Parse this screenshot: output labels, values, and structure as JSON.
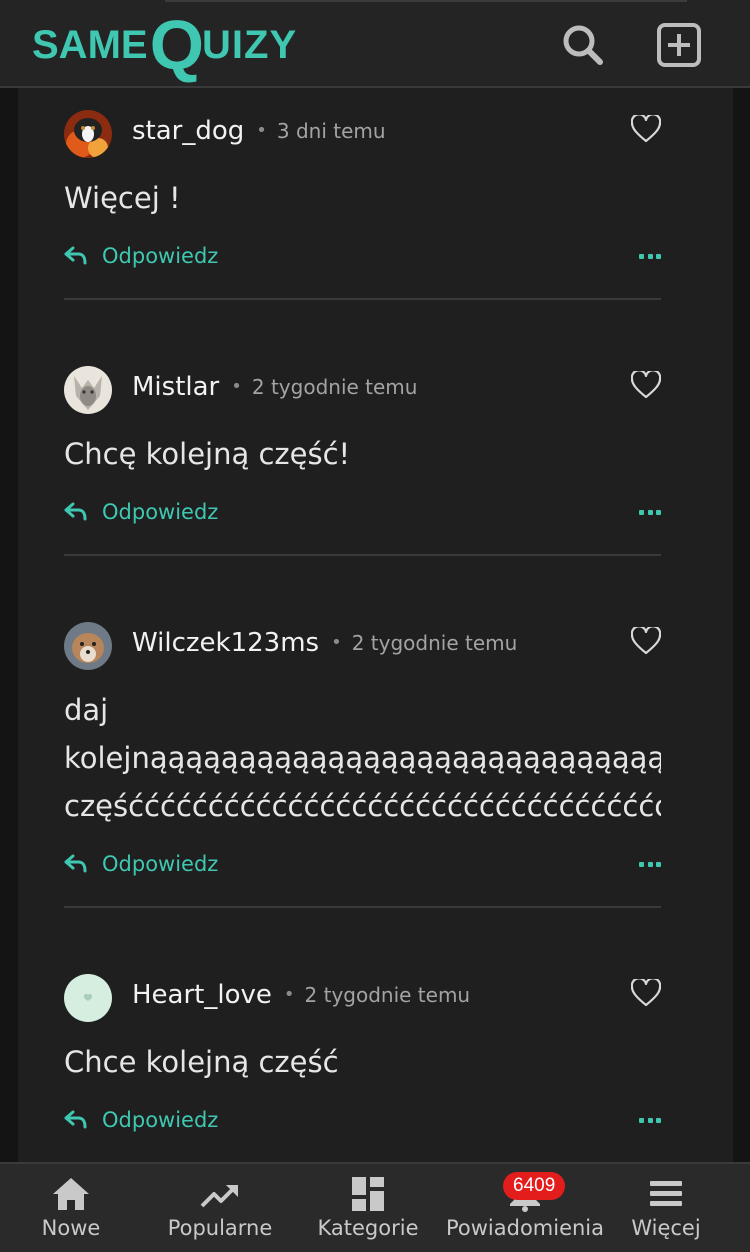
{
  "header": {
    "logo_same": "SAME",
    "logo_q": "Q",
    "logo_uizy": "UIZY",
    "search_icon": "search-icon",
    "add_icon": "plus-square-icon"
  },
  "colors": {
    "accent": "#3fc7b1",
    "badge": "#e31c1c",
    "background": "#1f1f1f"
  },
  "comments": [
    {
      "author": "star_dog",
      "time": "3 dni temu",
      "lines": [
        "Więcej !"
      ]
    },
    {
      "author": "Mistlar",
      "time": "2 tygodnie temu",
      "lines": [
        "Chcę kolejną część!"
      ]
    },
    {
      "author": "Wilczek123ms",
      "time": "2 tygodnie temu",
      "lines": [
        "daj",
        "kolejnąąąąąąąąąąąąąąąąąąąąąąąąąąąąąąąąą",
        "częśććććććććććććććććććććććććććććććććććć"
      ]
    },
    {
      "author": "Heart_love",
      "time": "2 tygodnie temu",
      "lines": [
        "Chce kolejną część"
      ]
    }
  ],
  "reply_label": "Odpowiedz",
  "nav": {
    "items": [
      {
        "label": "Nowe",
        "icon": "home-icon"
      },
      {
        "label": "Popularne",
        "icon": "trending-icon"
      },
      {
        "label": "Kategorie",
        "icon": "grid-icon"
      },
      {
        "label": "Powiadomienia",
        "icon": "bell-icon"
      },
      {
        "label": "Więcej",
        "icon": "menu-icon"
      }
    ],
    "notification_count": "6409"
  }
}
